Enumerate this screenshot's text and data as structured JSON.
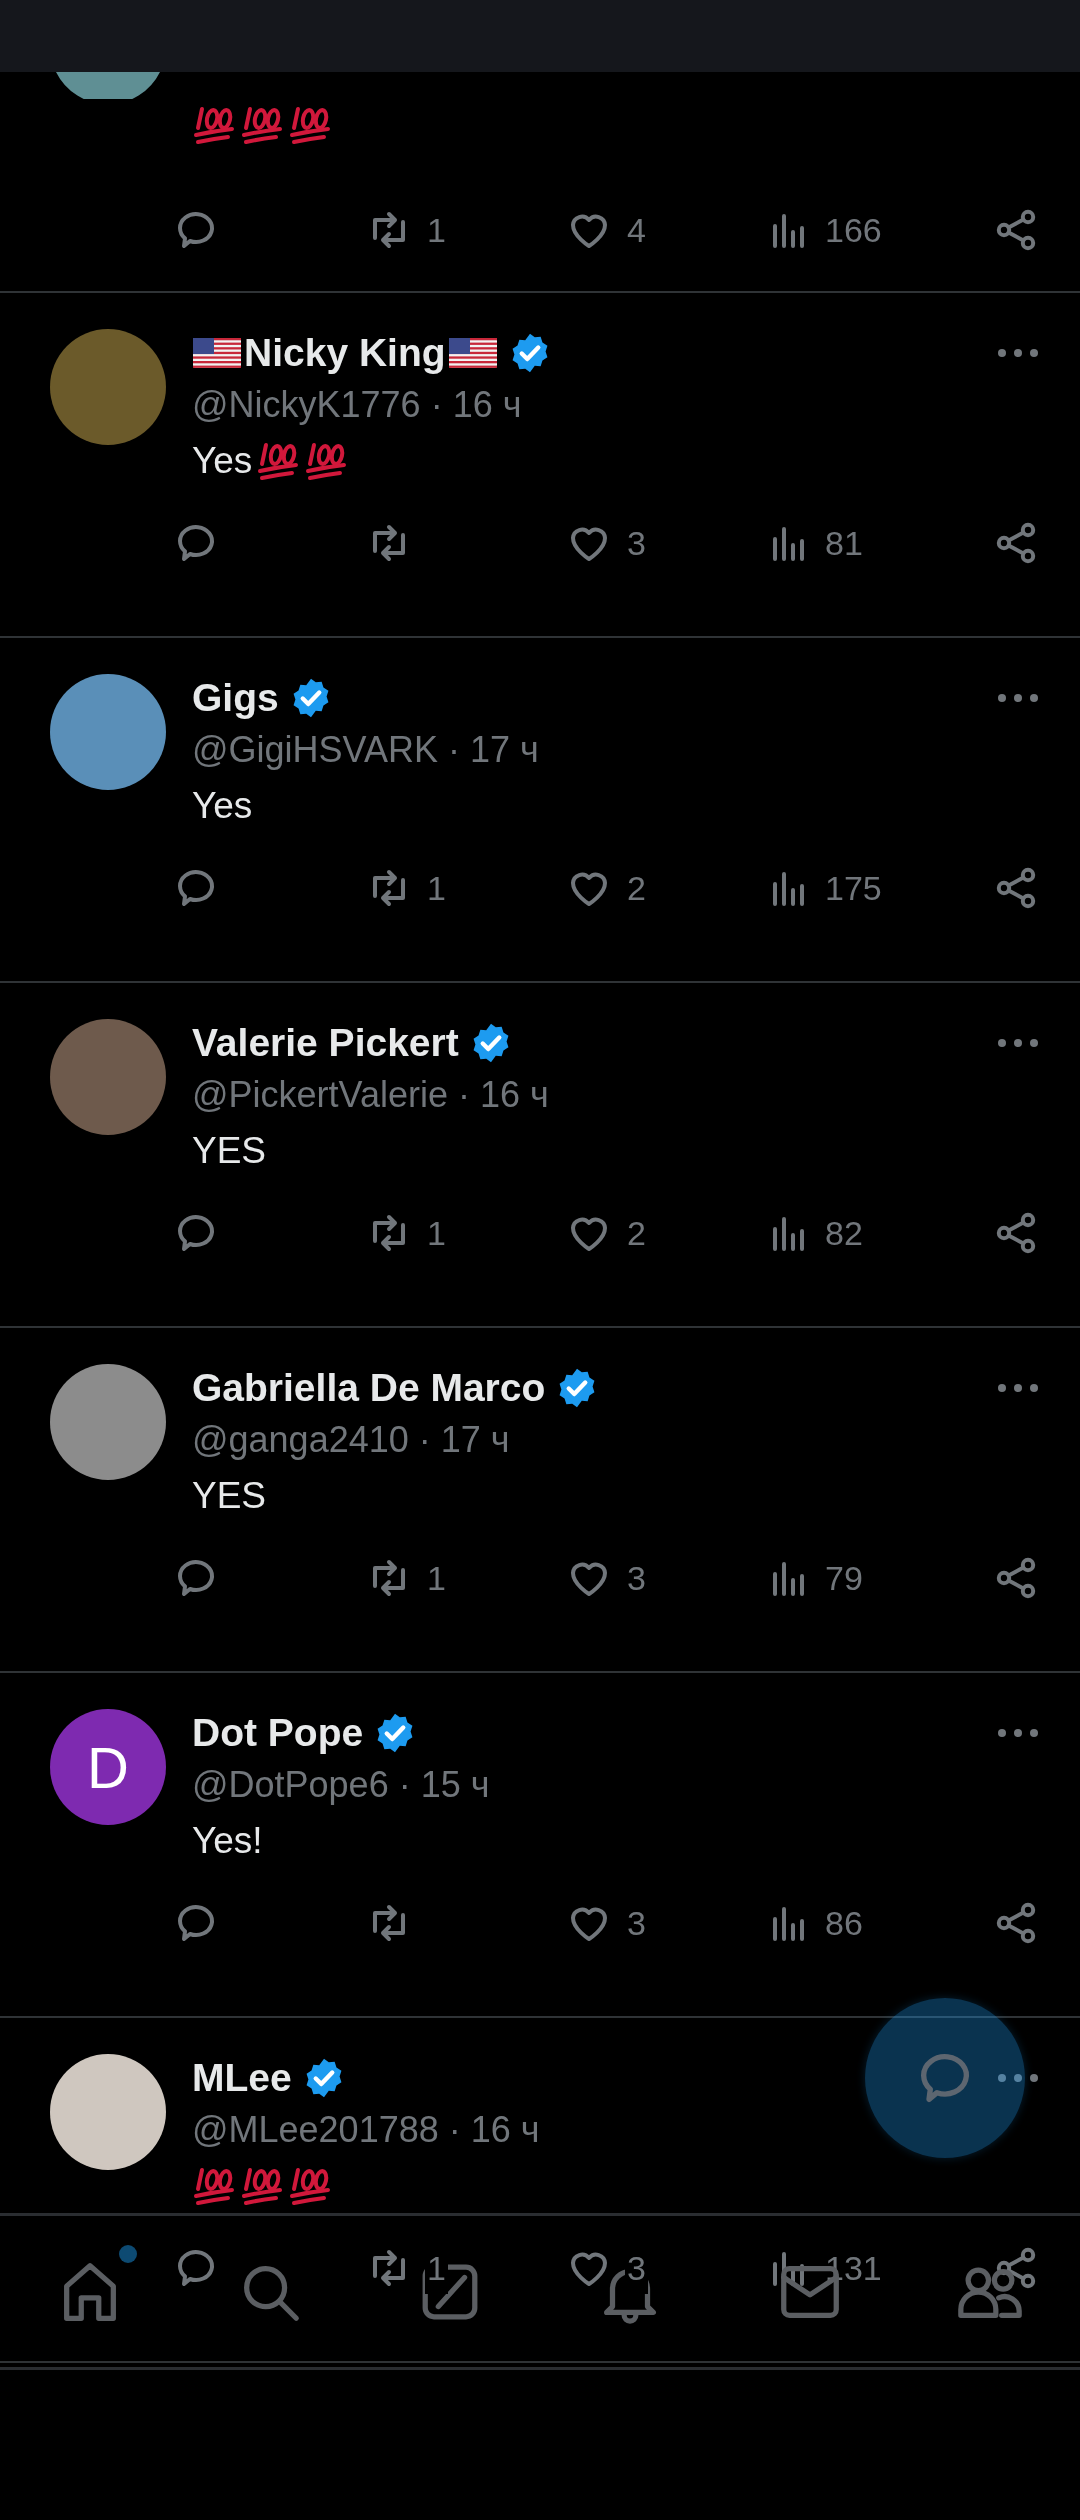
{
  "feed": [
    {
      "kind": "partial",
      "avatar": {
        "kind": "photo",
        "color": "#5f8f94"
      },
      "body_emoji": [
        {
          "kind": "hundred"
        },
        {
          "kind": "hundred"
        },
        {
          "kind": "hundred"
        }
      ],
      "actions": {
        "retweets": "1",
        "likes": "4",
        "views": "166"
      }
    },
    {
      "kind": "full",
      "name_prefix": [
        {
          "kind": "flag"
        }
      ],
      "name": "Nicky King",
      "name_suffix": [
        {
          "kind": "flag"
        }
      ],
      "verified": true,
      "avatar": {
        "kind": "photo",
        "color": "#6b5a2a"
      },
      "byline": "@NickyK1776 · 16 ч",
      "body": "Yes",
      "body_emoji": [
        {
          "kind": "hundred"
        },
        {
          "kind": "hundred"
        }
      ],
      "actions": {
        "likes": "3",
        "views": "81"
      }
    },
    {
      "kind": "full",
      "name": "Gigs",
      "verified": true,
      "avatar": {
        "kind": "photo",
        "color": "#5a8fb8"
      },
      "byline": "@GigiHSVARK · 17 ч",
      "body": "Yes",
      "actions": {
        "retweets": "1",
        "likes": "2",
        "views": "175"
      }
    },
    {
      "kind": "full",
      "name": "Valerie Pickert",
      "verified": true,
      "avatar": {
        "kind": "photo",
        "color": "#6e5a4c"
      },
      "byline": "@PickertValerie · 16 ч",
      "body": "YES",
      "actions": {
        "retweets": "1",
        "likes": "2",
        "views": "82"
      }
    },
    {
      "kind": "full",
      "name": "Gabriella De Marco",
      "verified": true,
      "avatar": {
        "kind": "photo",
        "color": "#8c8c8c"
      },
      "byline": "@ganga2410 · 17 ч",
      "body": "YES",
      "actions": {
        "retweets": "1",
        "likes": "3",
        "views": "79"
      }
    },
    {
      "kind": "full",
      "name": "Dot Pope",
      "verified": true,
      "avatar": {
        "kind": "letter",
        "letter": "D",
        "color": "#7e2ab0"
      },
      "byline": "@DotPope6 · 15 ч",
      "body": "Yes!",
      "actions": {
        "likes": "3",
        "views": "86"
      }
    },
    {
      "kind": "full",
      "name": "MLee",
      "verified": true,
      "avatar": {
        "kind": "photo",
        "color": "#cfc7bf"
      },
      "byline": "@MLee201788 · 16 ч",
      "body_emoji": [
        {
          "kind": "hundred"
        },
        {
          "kind": "hundred"
        },
        {
          "kind": "hundred"
        }
      ],
      "actions": {
        "retweets": "1",
        "likes": "3",
        "views": "131"
      }
    }
  ],
  "bottom_nav": [
    {
      "dot": true
    },
    {
      "dot": false
    },
    {
      "dot": false
    },
    {
      "dot": false
    },
    {
      "dot": false
    },
    {
      "dot": false
    }
  ]
}
